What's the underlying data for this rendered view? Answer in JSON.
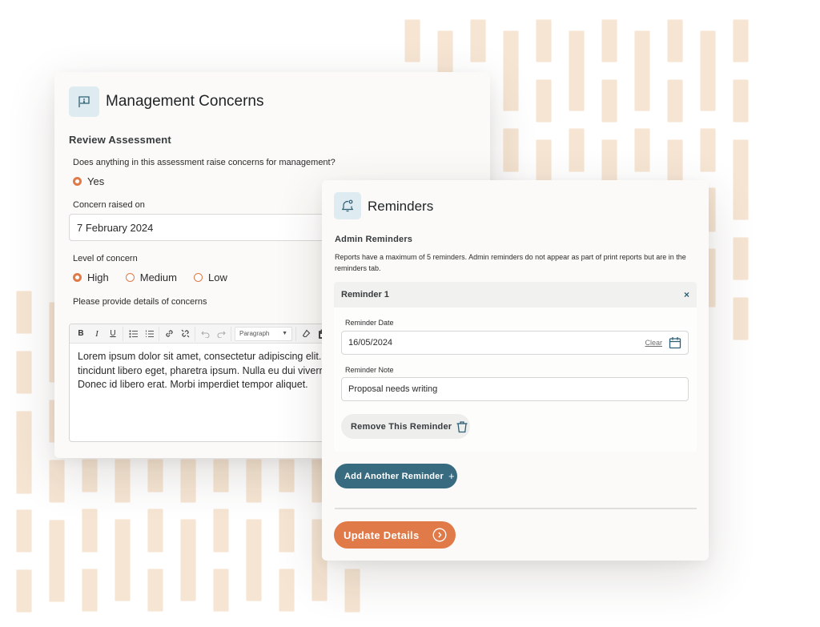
{
  "management_concerns": {
    "icon": "flag-alert-icon",
    "title": "Management Concerns",
    "section_title": "Review Assessment",
    "question": "Does anything in this assessment raise concerns for management?",
    "raise_concern_options": [
      {
        "label": "Yes",
        "selected": true
      }
    ],
    "concern_raised_on": {
      "label": "Concern raised on",
      "value": "7 February 2024"
    },
    "level_of_concern": {
      "label": "Level of concern",
      "options": [
        {
          "label": "High",
          "selected": true
        },
        {
          "label": "Medium",
          "selected": false
        },
        {
          "label": "Low",
          "selected": false
        }
      ]
    },
    "details": {
      "label": "Please provide details of concerns",
      "toolbar": {
        "bold": "B",
        "italic": "I",
        "underline": "U",
        "block_format": "Paragraph",
        "buttons": [
          "bold-icon",
          "italic-icon",
          "underline-icon",
          "bullet-list-icon",
          "numbered-list-icon",
          "link-icon",
          "unlink-icon",
          "undo-icon",
          "redo-icon",
          "block-format-select",
          "eraser-icon",
          "paste-icon",
          "omega-icon"
        ]
      },
      "lines": [
        "Lorem ipsum dolor sit amet, consectetur adipiscing elit. M",
        "tincidunt libero eget, pharetra ipsum. Nulla eu dui viverra t",
        "Donec id libero erat. Morbi imperdiet tempor aliquet."
      ]
    }
  },
  "reminders": {
    "icon": "bell-icon",
    "title": "Reminders",
    "section_title": "Admin Reminders",
    "help_text": "Reports have a maximum of 5 reminders. Admin reminders do not appear as part of print reports but are in the reminders tab.",
    "items": [
      {
        "title": "Reminder 1",
        "close": "×",
        "date_label": "Reminder Date",
        "date_value": "16/05/2024",
        "clear_label": "Clear",
        "note_label": "Reminder Note",
        "note_value": "Proposal needs writing",
        "remove_label": "Remove This Reminder"
      }
    ],
    "add_label": "Add Another Reminder",
    "add_icon": "+",
    "update_label": "Update Details"
  },
  "colors": {
    "accent_orange": "#e07a48",
    "accent_teal": "#386b80",
    "icon_tile_bg": "#deebf0",
    "pattern_bar": "#f6e5d3"
  }
}
